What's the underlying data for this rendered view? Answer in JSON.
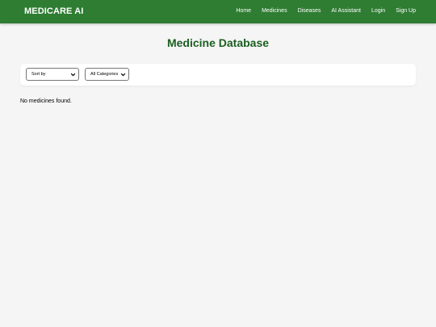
{
  "header": {
    "brand": "MEDICARE AI",
    "nav": [
      "Home",
      "Medicines",
      "Diseases",
      "AI Assistant",
      "Login",
      "Sign Up"
    ],
    "background_color": "#2e7d32"
  },
  "main": {
    "title": "Medicine Database",
    "title_color": "#1b5e20",
    "filters": {
      "sort_selected": "Sort by",
      "category_selected": "All Categories"
    },
    "empty_message": "No medicines found."
  }
}
